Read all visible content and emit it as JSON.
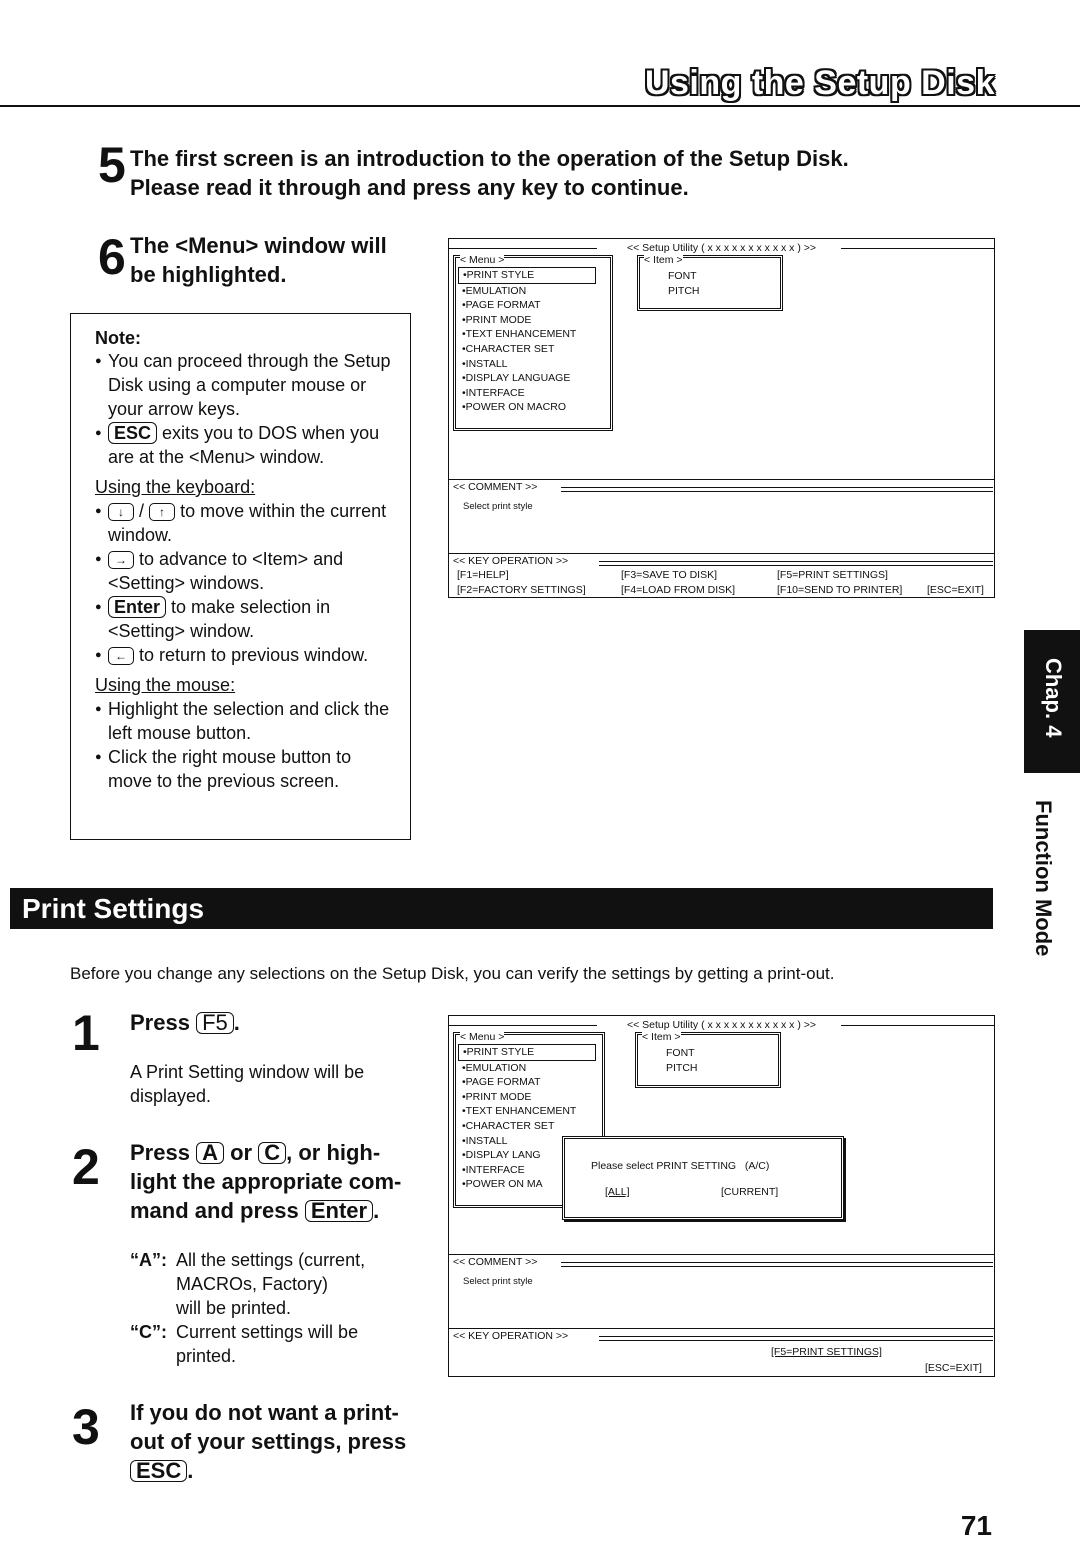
{
  "header": {
    "title": "Using the Setup Disk"
  },
  "steps_top": [
    {
      "num": "5",
      "lines": [
        "The first screen is an introduction to the operation of the Setup Disk.",
        "Please read it through and press any key to continue."
      ]
    },
    {
      "num": "6",
      "lines": [
        "The <Menu> window will",
        "be highlighted."
      ]
    }
  ],
  "note": {
    "heading": "Note:",
    "bullets1": [
      "You can proceed through the Setup Disk using a computer mouse or your arrow keys.",
      "exits you to DOS when you are at the <Menu> window."
    ],
    "esc_key": "ESC",
    "keyboard_heading": "Using the keyboard:",
    "keyboard_items": [
      {
        "keys": [
          "↓",
          "↑"
        ],
        "sep": "/",
        "text": "to move within the current window."
      },
      {
        "keys": [
          "→"
        ],
        "text": "to advance to <Item> and <Setting> windows."
      },
      {
        "keys": [
          "Enter"
        ],
        "text": "to make selection in <Setting> window."
      },
      {
        "keys": [
          "←"
        ],
        "text": "to return to previous window."
      }
    ],
    "mouse_heading": "Using the mouse:",
    "mouse_items": [
      "Highlight the selection and click the left mouse button.",
      "Click the right mouse button to move to the previous screen."
    ]
  },
  "screen1": {
    "title": "<< Setup Utility ( x x x x x x x x x x x ) >>",
    "menu_label": "< Menu >",
    "menu_items": [
      "PRINT STYLE",
      "EMULATION",
      "PAGE FORMAT",
      "PRINT MODE",
      "TEXT ENHANCEMENT",
      "CHARACTER SET",
      "INSTALL",
      "DISPLAY LANGUAGE",
      "INTERFACE",
      "POWER ON MACRO"
    ],
    "selected_index": 0,
    "item_label": "< Item >",
    "item_items": [
      "FONT",
      "PITCH"
    ],
    "comment_label": "<< COMMENT >>",
    "comment_text": "Select print style",
    "keyop_label": "<< KEY OPERATION >>",
    "keyops": [
      [
        "[F1=HELP]",
        "[F3=SAVE TO DISK]",
        "[F5=PRINT SETTINGS]",
        ""
      ],
      [
        "[F2=FACTORY SETTINGS]",
        "[F4=LOAD FROM DISK]",
        "[F10=SEND TO PRINTER]",
        "[ESC=EXIT]"
      ]
    ]
  },
  "section": {
    "title": "Print Settings"
  },
  "side_tab": {
    "chapter": "Chap. 4",
    "label": "Function Mode"
  },
  "intro": "Before you change any selections on the Setup Disk, you can verify the settings by getting a print-out.",
  "steps_bottom": [
    {
      "num": "1",
      "pre": "Press",
      "key": "F5",
      "post": ".",
      "desc": "A Print Setting window will be displayed."
    },
    {
      "num": "2",
      "line1_pre": "Press",
      "key_a": "A",
      "mid": "or",
      "key_c": "C",
      "line1_post": ", or high-",
      "line2": "light the appropriate com-",
      "line3_pre": "mand and press",
      "key_enter": "Enter",
      "line3_post": ".",
      "options": [
        {
          "key": "“A”:",
          "lines": [
            "All the settings (current,",
            "MACROs, Factory)",
            "will be printed."
          ]
        },
        {
          "key": "“C”:",
          "lines": [
            "Current settings will be",
            "printed."
          ]
        }
      ]
    },
    {
      "num": "3",
      "line1": "If you do not want a print-",
      "line2": "out of your settings, press",
      "key": "ESC",
      "post": "."
    }
  ],
  "screen2": {
    "title": "<< Setup Utility ( x x x x x x x x x x x ) >>",
    "menu_label": "< Menu >",
    "menu_items": [
      "PRINT STYLE",
      "EMULATION",
      "PAGE FORMAT",
      "PRINT MODE",
      "TEXT ENHANCEMENT",
      "CHARACTER SET",
      "INSTALL",
      "DISPLAY LANG",
      "INTERFACE",
      "POWER ON MA"
    ],
    "item_label": "< Item >",
    "item_items": [
      "FONT",
      "PITCH"
    ],
    "dialog_prompt": "Please select PRINT SETTING   (A/C)",
    "dialog_all": "[ALL]",
    "dialog_current": "[CURRENT]",
    "comment_label": "<< COMMENT >>",
    "comment_text": "Select print style",
    "keyop_label": "<< KEY OPERATION >>",
    "keyop_f5": "[F5=PRINT SETTINGS]",
    "keyop_esc": "[ESC=EXIT]"
  },
  "page_number": "71"
}
